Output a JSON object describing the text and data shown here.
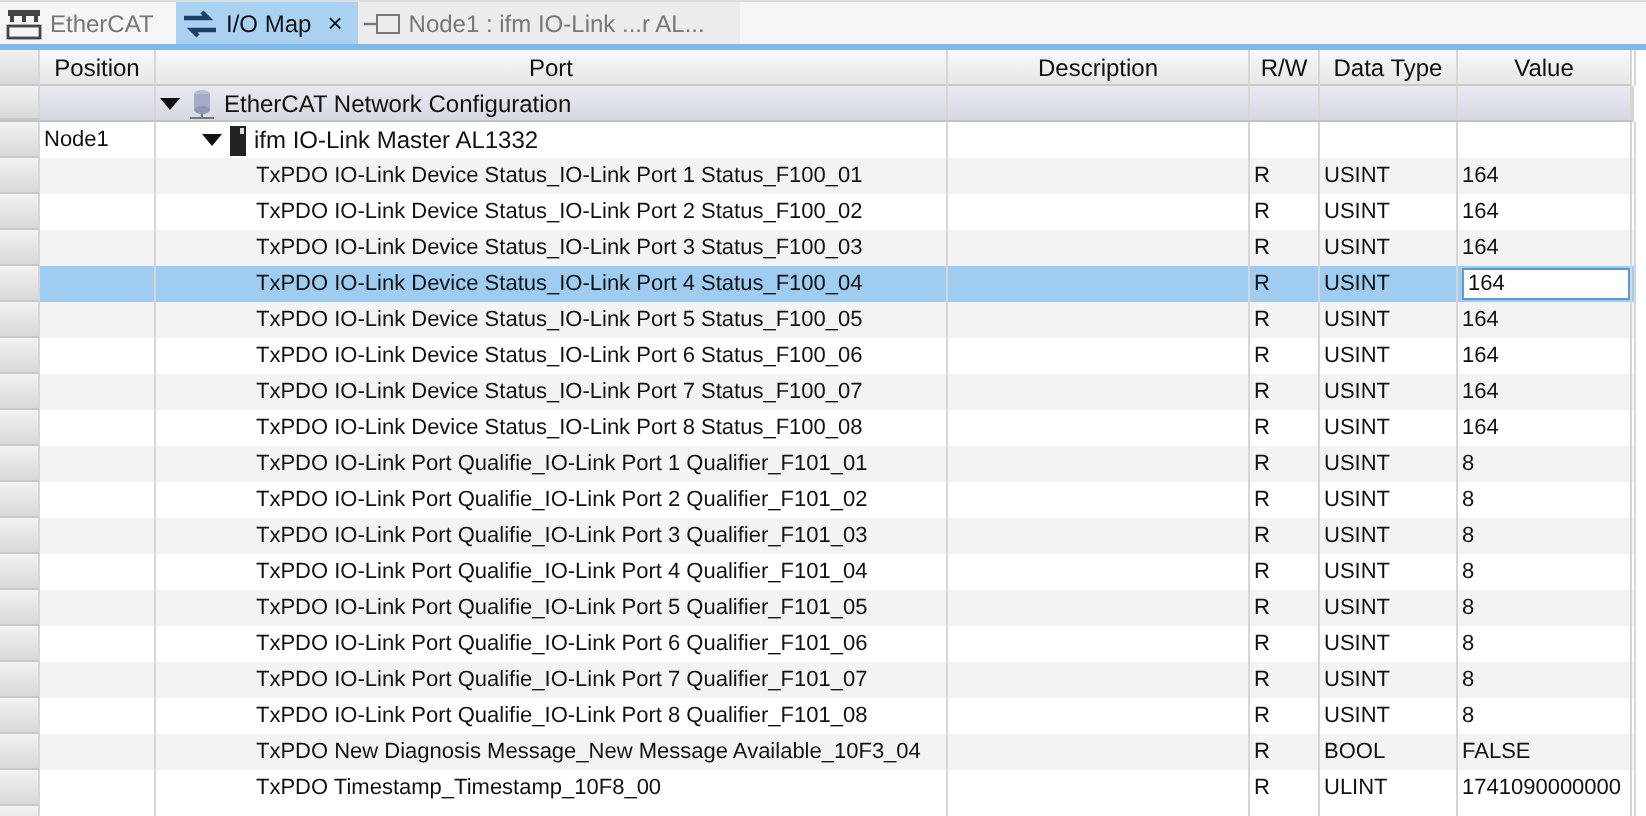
{
  "tabs": [
    {
      "kind": "ethercat",
      "label": "EtherCAT",
      "selected": false
    },
    {
      "kind": "iomap",
      "label": "I/O Map",
      "selected": true,
      "close": "×"
    },
    {
      "kind": "node",
      "label": "Node1 : ifm IO-Link ...r AL...",
      "selected": false
    }
  ],
  "table": {
    "columns": [
      "Position",
      "Port",
      "Description",
      "R/W",
      "Data Type",
      "Value"
    ],
    "tree": {
      "port": "EtherCAT Network Configuration",
      "expanded": true,
      "children": [
        {
          "position": "Node1",
          "port": "ifm IO-Link Master AL1332",
          "expanded": true,
          "children": [
            {
              "port": "TxPDO IO-Link Device Status_IO-Link Port 1 Status_F100_01",
              "rw": "R",
              "data_type": "USINT",
              "value": "164",
              "selected": false
            },
            {
              "port": "TxPDO IO-Link Device Status_IO-Link Port 2 Status_F100_02",
              "rw": "R",
              "data_type": "USINT",
              "value": "164",
              "selected": false
            },
            {
              "port": "TxPDO IO-Link Device Status_IO-Link Port 3 Status_F100_03",
              "rw": "R",
              "data_type": "USINT",
              "value": "164",
              "selected": false
            },
            {
              "port": "TxPDO IO-Link Device Status_IO-Link Port 4 Status_F100_04",
              "rw": "R",
              "data_type": "USINT",
              "value": "164",
              "selected": true
            },
            {
              "port": "TxPDO IO-Link Device Status_IO-Link Port 5 Status_F100_05",
              "rw": "R",
              "data_type": "USINT",
              "value": "164",
              "selected": false
            },
            {
              "port": "TxPDO IO-Link Device Status_IO-Link Port 6 Status_F100_06",
              "rw": "R",
              "data_type": "USINT",
              "value": "164",
              "selected": false
            },
            {
              "port": "TxPDO IO-Link Device Status_IO-Link Port 7 Status_F100_07",
              "rw": "R",
              "data_type": "USINT",
              "value": "164",
              "selected": false
            },
            {
              "port": "TxPDO IO-Link Device Status_IO-Link Port 8 Status_F100_08",
              "rw": "R",
              "data_type": "USINT",
              "value": "164",
              "selected": false
            },
            {
              "port": "TxPDO IO-Link Port Qualifie_IO-Link Port 1 Qualifier_F101_01",
              "rw": "R",
              "data_type": "USINT",
              "value": "8",
              "selected": false
            },
            {
              "port": "TxPDO IO-Link Port Qualifie_IO-Link Port 2 Qualifier_F101_02",
              "rw": "R",
              "data_type": "USINT",
              "value": "8",
              "selected": false
            },
            {
              "port": "TxPDO IO-Link Port Qualifie_IO-Link Port 3 Qualifier_F101_03",
              "rw": "R",
              "data_type": "USINT",
              "value": "8",
              "selected": false
            },
            {
              "port": "TxPDO IO-Link Port Qualifie_IO-Link Port 4 Qualifier_F101_04",
              "rw": "R",
              "data_type": "USINT",
              "value": "8",
              "selected": false
            },
            {
              "port": "TxPDO IO-Link Port Qualifie_IO-Link Port 5 Qualifier_F101_05",
              "rw": "R",
              "data_type": "USINT",
              "value": "8",
              "selected": false
            },
            {
              "port": "TxPDO IO-Link Port Qualifie_IO-Link Port 6 Qualifier_F101_06",
              "rw": "R",
              "data_type": "USINT",
              "value": "8",
              "selected": false
            },
            {
              "port": "TxPDO IO-Link Port Qualifie_IO-Link Port 7 Qualifier_F101_07",
              "rw": "R",
              "data_type": "USINT",
              "value": "8",
              "selected": false
            },
            {
              "port": "TxPDO IO-Link Port Qualifie_IO-Link Port 8 Qualifier_F101_08",
              "rw": "R",
              "data_type": "USINT",
              "value": "8",
              "selected": false
            },
            {
              "port": "TxPDO New Diagnosis Message_New Message Available_10F3_04",
              "rw": "R",
              "data_type": "BOOL",
              "value": "FALSE",
              "selected": false
            },
            {
              "port": "TxPDO Timestamp_Timestamp_10F8_00",
              "rw": "R",
              "data_type": "ULINT",
              "value": "1741090000000",
              "selected": false
            }
          ]
        }
      ]
    }
  }
}
